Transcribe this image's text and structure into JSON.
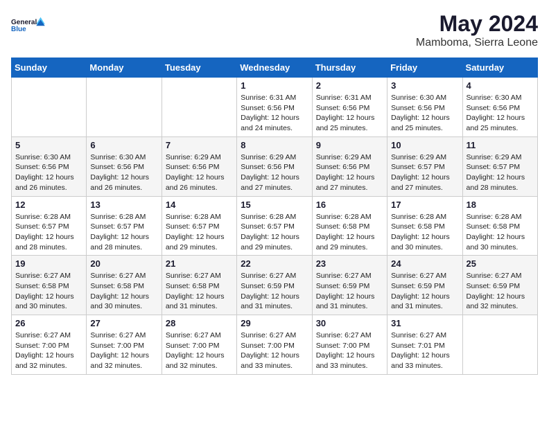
{
  "logo": {
    "line1": "General",
    "line2": "Blue"
  },
  "title": "May 2024",
  "location": "Mamboma, Sierra Leone",
  "days_of_week": [
    "Sunday",
    "Monday",
    "Tuesday",
    "Wednesday",
    "Thursday",
    "Friday",
    "Saturday"
  ],
  "weeks": [
    [
      {
        "day": "",
        "info": ""
      },
      {
        "day": "",
        "info": ""
      },
      {
        "day": "",
        "info": ""
      },
      {
        "day": "1",
        "info": "Sunrise: 6:31 AM\nSunset: 6:56 PM\nDaylight: 12 hours\nand 24 minutes."
      },
      {
        "day": "2",
        "info": "Sunrise: 6:31 AM\nSunset: 6:56 PM\nDaylight: 12 hours\nand 25 minutes."
      },
      {
        "day": "3",
        "info": "Sunrise: 6:30 AM\nSunset: 6:56 PM\nDaylight: 12 hours\nand 25 minutes."
      },
      {
        "day": "4",
        "info": "Sunrise: 6:30 AM\nSunset: 6:56 PM\nDaylight: 12 hours\nand 25 minutes."
      }
    ],
    [
      {
        "day": "5",
        "info": "Sunrise: 6:30 AM\nSunset: 6:56 PM\nDaylight: 12 hours\nand 26 minutes."
      },
      {
        "day": "6",
        "info": "Sunrise: 6:30 AM\nSunset: 6:56 PM\nDaylight: 12 hours\nand 26 minutes."
      },
      {
        "day": "7",
        "info": "Sunrise: 6:29 AM\nSunset: 6:56 PM\nDaylight: 12 hours\nand 26 minutes."
      },
      {
        "day": "8",
        "info": "Sunrise: 6:29 AM\nSunset: 6:56 PM\nDaylight: 12 hours\nand 27 minutes."
      },
      {
        "day": "9",
        "info": "Sunrise: 6:29 AM\nSunset: 6:56 PM\nDaylight: 12 hours\nand 27 minutes."
      },
      {
        "day": "10",
        "info": "Sunrise: 6:29 AM\nSunset: 6:57 PM\nDaylight: 12 hours\nand 27 minutes."
      },
      {
        "day": "11",
        "info": "Sunrise: 6:29 AM\nSunset: 6:57 PM\nDaylight: 12 hours\nand 28 minutes."
      }
    ],
    [
      {
        "day": "12",
        "info": "Sunrise: 6:28 AM\nSunset: 6:57 PM\nDaylight: 12 hours\nand 28 minutes."
      },
      {
        "day": "13",
        "info": "Sunrise: 6:28 AM\nSunset: 6:57 PM\nDaylight: 12 hours\nand 28 minutes."
      },
      {
        "day": "14",
        "info": "Sunrise: 6:28 AM\nSunset: 6:57 PM\nDaylight: 12 hours\nand 29 minutes."
      },
      {
        "day": "15",
        "info": "Sunrise: 6:28 AM\nSunset: 6:57 PM\nDaylight: 12 hours\nand 29 minutes."
      },
      {
        "day": "16",
        "info": "Sunrise: 6:28 AM\nSunset: 6:58 PM\nDaylight: 12 hours\nand 29 minutes."
      },
      {
        "day": "17",
        "info": "Sunrise: 6:28 AM\nSunset: 6:58 PM\nDaylight: 12 hours\nand 30 minutes."
      },
      {
        "day": "18",
        "info": "Sunrise: 6:28 AM\nSunset: 6:58 PM\nDaylight: 12 hours\nand 30 minutes."
      }
    ],
    [
      {
        "day": "19",
        "info": "Sunrise: 6:27 AM\nSunset: 6:58 PM\nDaylight: 12 hours\nand 30 minutes."
      },
      {
        "day": "20",
        "info": "Sunrise: 6:27 AM\nSunset: 6:58 PM\nDaylight: 12 hours\nand 30 minutes."
      },
      {
        "day": "21",
        "info": "Sunrise: 6:27 AM\nSunset: 6:58 PM\nDaylight: 12 hours\nand 31 minutes."
      },
      {
        "day": "22",
        "info": "Sunrise: 6:27 AM\nSunset: 6:59 PM\nDaylight: 12 hours\nand 31 minutes."
      },
      {
        "day": "23",
        "info": "Sunrise: 6:27 AM\nSunset: 6:59 PM\nDaylight: 12 hours\nand 31 minutes."
      },
      {
        "day": "24",
        "info": "Sunrise: 6:27 AM\nSunset: 6:59 PM\nDaylight: 12 hours\nand 31 minutes."
      },
      {
        "day": "25",
        "info": "Sunrise: 6:27 AM\nSunset: 6:59 PM\nDaylight: 12 hours\nand 32 minutes."
      }
    ],
    [
      {
        "day": "26",
        "info": "Sunrise: 6:27 AM\nSunset: 7:00 PM\nDaylight: 12 hours\nand 32 minutes."
      },
      {
        "day": "27",
        "info": "Sunrise: 6:27 AM\nSunset: 7:00 PM\nDaylight: 12 hours\nand 32 minutes."
      },
      {
        "day": "28",
        "info": "Sunrise: 6:27 AM\nSunset: 7:00 PM\nDaylight: 12 hours\nand 32 minutes."
      },
      {
        "day": "29",
        "info": "Sunrise: 6:27 AM\nSunset: 7:00 PM\nDaylight: 12 hours\nand 33 minutes."
      },
      {
        "day": "30",
        "info": "Sunrise: 6:27 AM\nSunset: 7:00 PM\nDaylight: 12 hours\nand 33 minutes."
      },
      {
        "day": "31",
        "info": "Sunrise: 6:27 AM\nSunset: 7:01 PM\nDaylight: 12 hours\nand 33 minutes."
      },
      {
        "day": "",
        "info": ""
      }
    ]
  ]
}
